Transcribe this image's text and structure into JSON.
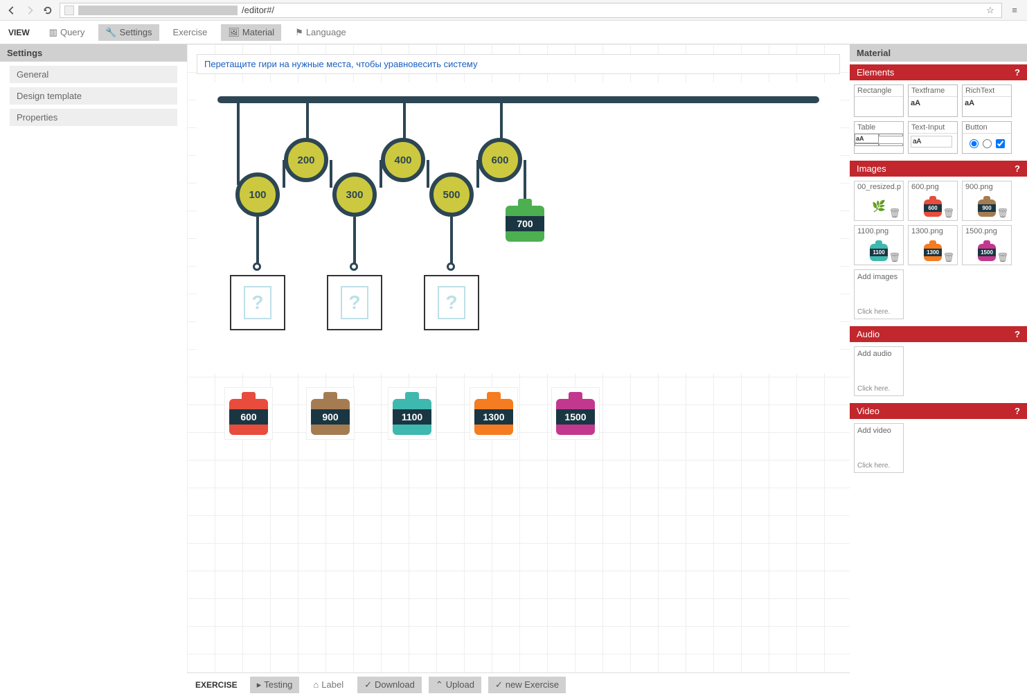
{
  "browser": {
    "url_path": "/editor#/"
  },
  "toolbar": {
    "view_label": "VIEW",
    "query": "Query",
    "settings": "Settings",
    "exercise": "Exercise",
    "material": "Material",
    "language": "Language"
  },
  "left_panel": {
    "title": "Settings",
    "items": [
      "General",
      "Design template",
      "Properties"
    ]
  },
  "canvas": {
    "instruction": "Перетащите гири на нужные места, чтобы уравновесить систему",
    "pulleys": [
      {
        "value": "100"
      },
      {
        "value": "200"
      },
      {
        "value": "300"
      },
      {
        "value": "400"
      },
      {
        "value": "500"
      },
      {
        "value": "600"
      }
    ],
    "fixed_weight": {
      "value": "700",
      "color": "green"
    },
    "drop_slots": 3,
    "draggable_weights": [
      {
        "value": "600",
        "color": "red"
      },
      {
        "value": "900",
        "color": "brown"
      },
      {
        "value": "1100",
        "color": "teal"
      },
      {
        "value": "1300",
        "color": "orange"
      },
      {
        "value": "1500",
        "color": "magenta"
      }
    ]
  },
  "right_panel": {
    "title": "Material",
    "elements": {
      "header": "Elements",
      "items": [
        "Rectangle",
        "Textframe",
        "RichText",
        "Table",
        "Text-Input",
        "Button"
      ],
      "sample": "aA"
    },
    "images": {
      "header": "Images",
      "items": [
        {
          "name": "00_resized.p",
          "weight": null
        },
        {
          "name": "600.png",
          "weight": "600",
          "color": "red"
        },
        {
          "name": "900.png",
          "weight": "900",
          "color": "brown"
        },
        {
          "name": "1100.png",
          "weight": "1100",
          "color": "teal"
        },
        {
          "name": "1300.png",
          "weight": "1300",
          "color": "orange"
        },
        {
          "name": "1500.png",
          "weight": "1500",
          "color": "magenta"
        }
      ],
      "add_label": "Add images",
      "click_label": "Click here."
    },
    "audio": {
      "header": "Audio",
      "add_label": "Add audio",
      "click_label": "Click here."
    },
    "video": {
      "header": "Video",
      "add_label": "Add video",
      "click_label": "Click here."
    },
    "help": "?"
  },
  "bottom_toolbar": {
    "exercise_label": "EXERCISE",
    "testing": "Testing",
    "label_btn": "Label",
    "download": "Download",
    "upload": "Upload",
    "new_exercise": "new Exercise"
  }
}
